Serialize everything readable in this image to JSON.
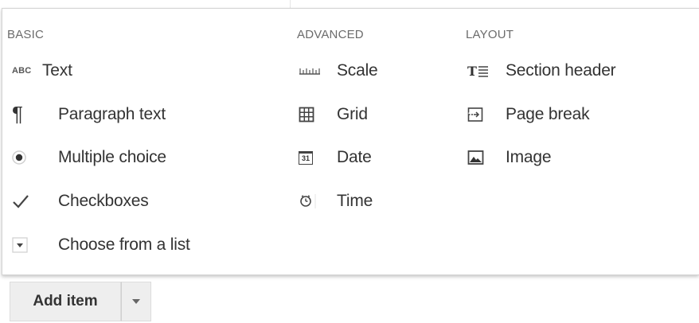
{
  "menu": {
    "basic": {
      "header": "BASIC",
      "items": [
        {
          "label": "Text",
          "icon": "abc-text-icon",
          "icon_text": "ABC"
        },
        {
          "label": "Paragraph text",
          "icon": "pilcrow-icon",
          "icon_text": "¶"
        },
        {
          "label": "Multiple choice",
          "icon": "radio-button-icon"
        },
        {
          "label": "Checkboxes",
          "icon": "checkmark-icon"
        },
        {
          "label": "Choose from a list",
          "icon": "dropdown-list-icon"
        }
      ]
    },
    "advanced": {
      "header": "ADVANCED",
      "items": [
        {
          "label": "Scale",
          "icon": "scale-ruler-icon"
        },
        {
          "label": "Grid",
          "icon": "grid-icon"
        },
        {
          "label": "Date",
          "icon": "calendar-icon",
          "icon_text": "31"
        },
        {
          "label": "Time",
          "icon": "clock-icon"
        }
      ]
    },
    "layout": {
      "header": "LAYOUT",
      "items": [
        {
          "label": "Section header",
          "icon": "section-header-icon"
        },
        {
          "label": "Page break",
          "icon": "page-break-icon"
        },
        {
          "label": "Image",
          "icon": "image-icon"
        }
      ]
    }
  },
  "add_item": {
    "label": "Add item",
    "dropdown_icon": "caret-down-icon"
  },
  "colors": {
    "text": "#333333",
    "header_text": "#6b6b6b",
    "button_bg": "#eeeeee",
    "border": "#d4d4d4"
  }
}
